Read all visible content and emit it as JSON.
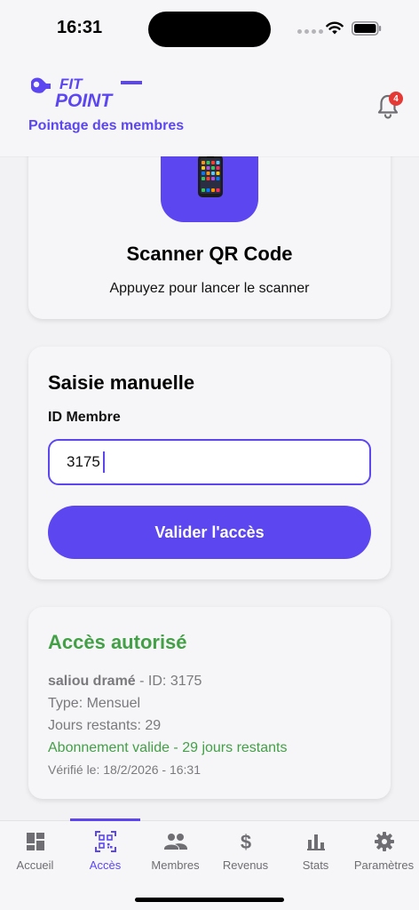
{
  "status_bar": {
    "time": "16:31"
  },
  "header": {
    "logo_text_top": "FIT",
    "logo_text_bottom": "POINT",
    "subtitle": "Pointage des membres",
    "notification_count": "4"
  },
  "scanner": {
    "title": "Scanner QR Code",
    "description": "Appuyez pour lancer le scanner"
  },
  "manual": {
    "title": "Saisie manuelle",
    "field_label": "ID Membre",
    "field_value": "3175",
    "button_label": "Valider l'accès"
  },
  "result": {
    "title": "Accès autorisé",
    "member_name": "saliou dramé",
    "member_id": " - ID: 3175",
    "type": "Type: Mensuel",
    "days_left": "Jours restants: 29",
    "validity": "Abonnement valide - 29 jours restants",
    "verified_at": "Vérifié le: 18/2/2026 - 16:31"
  },
  "tabs": [
    {
      "label": "Accueil",
      "icon": "dashboard-icon",
      "active": false
    },
    {
      "label": "Accès",
      "icon": "qr-code-icon",
      "active": true
    },
    {
      "label": "Membres",
      "icon": "people-icon",
      "active": false
    },
    {
      "label": "Revenus",
      "icon": "dollar-icon",
      "active": false
    },
    {
      "label": "Stats",
      "icon": "bar-chart-icon",
      "active": false
    },
    {
      "label": "Paramètres",
      "icon": "gear-icon",
      "active": false
    }
  ],
  "colors": {
    "primary": "#5b46f0",
    "success": "#43a047",
    "badge": "#e53935"
  }
}
